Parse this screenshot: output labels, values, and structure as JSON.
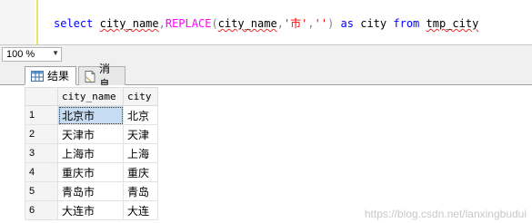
{
  "editor": {
    "sql": {
      "select": "select",
      "col1": "city_name",
      "comma1": ",",
      "replace": "REPLACE",
      "lparen": "(",
      "col2": "city_name",
      "comma2": ",",
      "str1": "'市'",
      "comma3": ",",
      "str2": "''",
      "rparen": ")",
      "as": "as",
      "alias": "city",
      "from": "from",
      "table": "tmp_city"
    }
  },
  "zoom": {
    "value": "100 %"
  },
  "tabs": [
    {
      "label": "结果",
      "icon": "grid-icon"
    },
    {
      "label": "消息",
      "icon": "message-icon"
    }
  ],
  "grid": {
    "columns": [
      "city_name",
      "city"
    ],
    "rows": [
      {
        "num": "1",
        "city_name": "北京市",
        "city": "北京"
      },
      {
        "num": "2",
        "city_name": "天津市",
        "city": "天津"
      },
      {
        "num": "3",
        "city_name": "上海市",
        "city": "上海"
      },
      {
        "num": "4",
        "city_name": "重庆市",
        "city": "重庆"
      },
      {
        "num": "5",
        "city_name": "青岛市",
        "city": "青岛"
      },
      {
        "num": "6",
        "city_name": "大连市",
        "city": "大连"
      }
    ]
  },
  "watermark": "https://blog.csdn.net/lanxingbudui",
  "colors": {
    "keyword": "#0000ff",
    "function": "#ff00ff",
    "string": "#ff0000",
    "selection": "#c6dcf2"
  }
}
